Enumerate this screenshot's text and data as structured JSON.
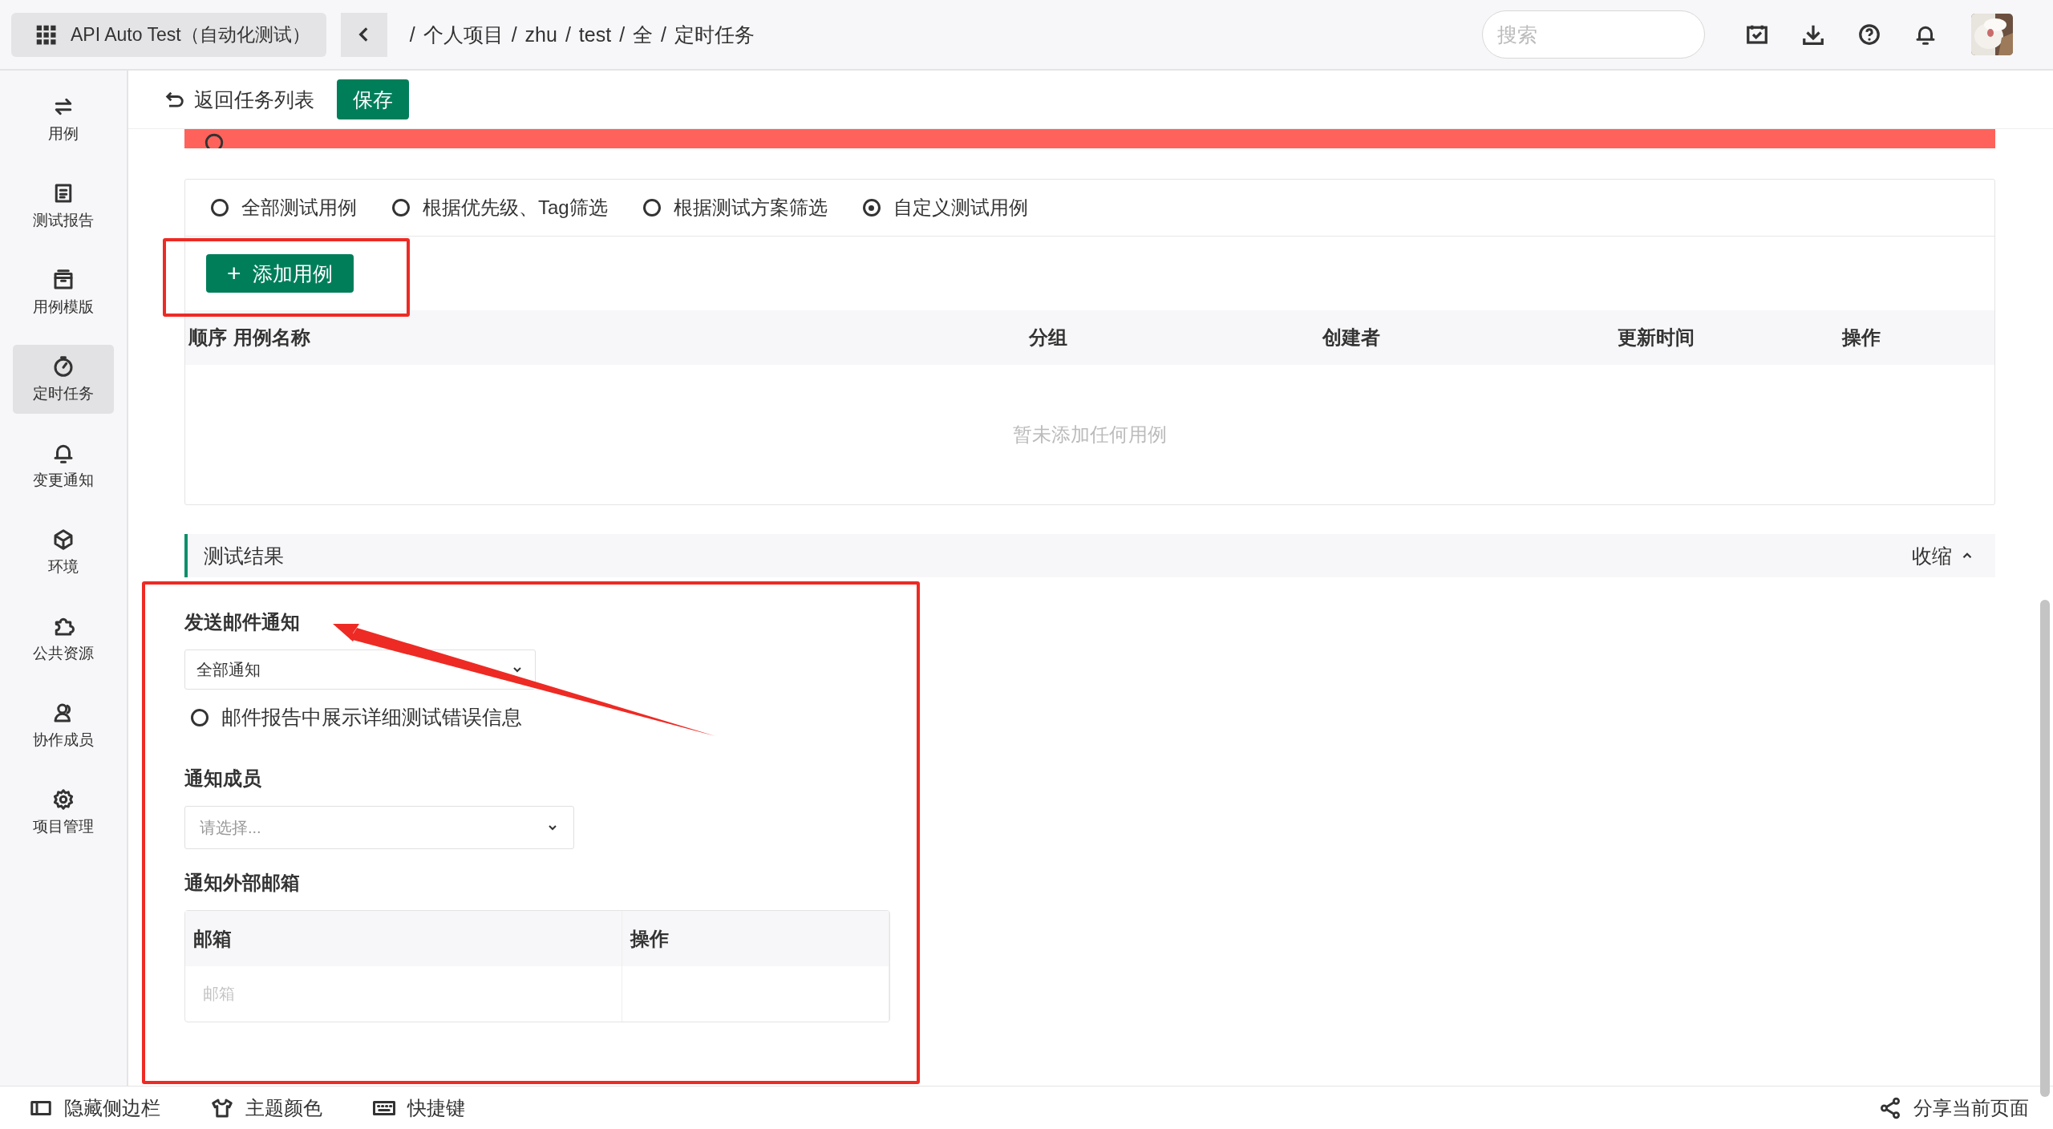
{
  "app_button": {
    "label": "API Auto Test（自动化测试）"
  },
  "breadcrumb": {
    "separator": "/",
    "items": [
      "个人项目",
      "zhu",
      "test",
      "全",
      "定时任务"
    ]
  },
  "search": {
    "placeholder": "搜索"
  },
  "sidebar": {
    "items": [
      {
        "label": "用例",
        "kind": "swap",
        "selected": false
      },
      {
        "label": "测试报告",
        "kind": "report",
        "selected": false
      },
      {
        "label": "用例模版",
        "kind": "template",
        "selected": false
      },
      {
        "label": "定时任务",
        "kind": "timer",
        "selected": true
      },
      {
        "label": "变更通知",
        "kind": "bell",
        "selected": false
      },
      {
        "label": "环境",
        "kind": "cube",
        "selected": false
      },
      {
        "label": "公共资源",
        "kind": "puzzle",
        "selected": false
      },
      {
        "label": "协作成员",
        "kind": "user",
        "selected": false
      },
      {
        "label": "项目管理",
        "kind": "gear",
        "selected": false
      }
    ]
  },
  "toolbar": {
    "back": "返回任务列表",
    "save": "保存"
  },
  "scope_options": [
    {
      "label": "全部测试用例",
      "selected": false
    },
    {
      "label": "根据优先级、Tag筛选",
      "selected": false
    },
    {
      "label": "根据测试方案筛选",
      "selected": false
    },
    {
      "label": "自定义测试用例",
      "selected": true
    }
  ],
  "add_button": {
    "plus": "+",
    "label": "添加用例"
  },
  "case_table": {
    "columns": [
      "顺序",
      "用例名称",
      "分组",
      "创建者",
      "更新时间",
      "操作"
    ],
    "empty": "暂未添加任何用例"
  },
  "result_section": {
    "title": "测试结果",
    "toggle": "收缩",
    "expanded": true
  },
  "email": {
    "title": "发送邮件通知",
    "select_value": "全部通知",
    "detail_option": {
      "label": "邮件报告中展示详细测试错误信息",
      "checked": false
    }
  },
  "members": {
    "title": "通知成员",
    "placeholder": "请选择..."
  },
  "external": {
    "title": "通知外部邮箱",
    "columns": [
      "邮箱",
      "操作"
    ],
    "email_placeholder": "邮箱"
  },
  "footer": {
    "items": [
      {
        "label": "隐藏侧边栏",
        "kind": "sidebar"
      },
      {
        "label": "主题颜色",
        "kind": "shirt"
      },
      {
        "label": "快捷键",
        "kind": "keyboard"
      }
    ],
    "share": "分享当前页面"
  }
}
